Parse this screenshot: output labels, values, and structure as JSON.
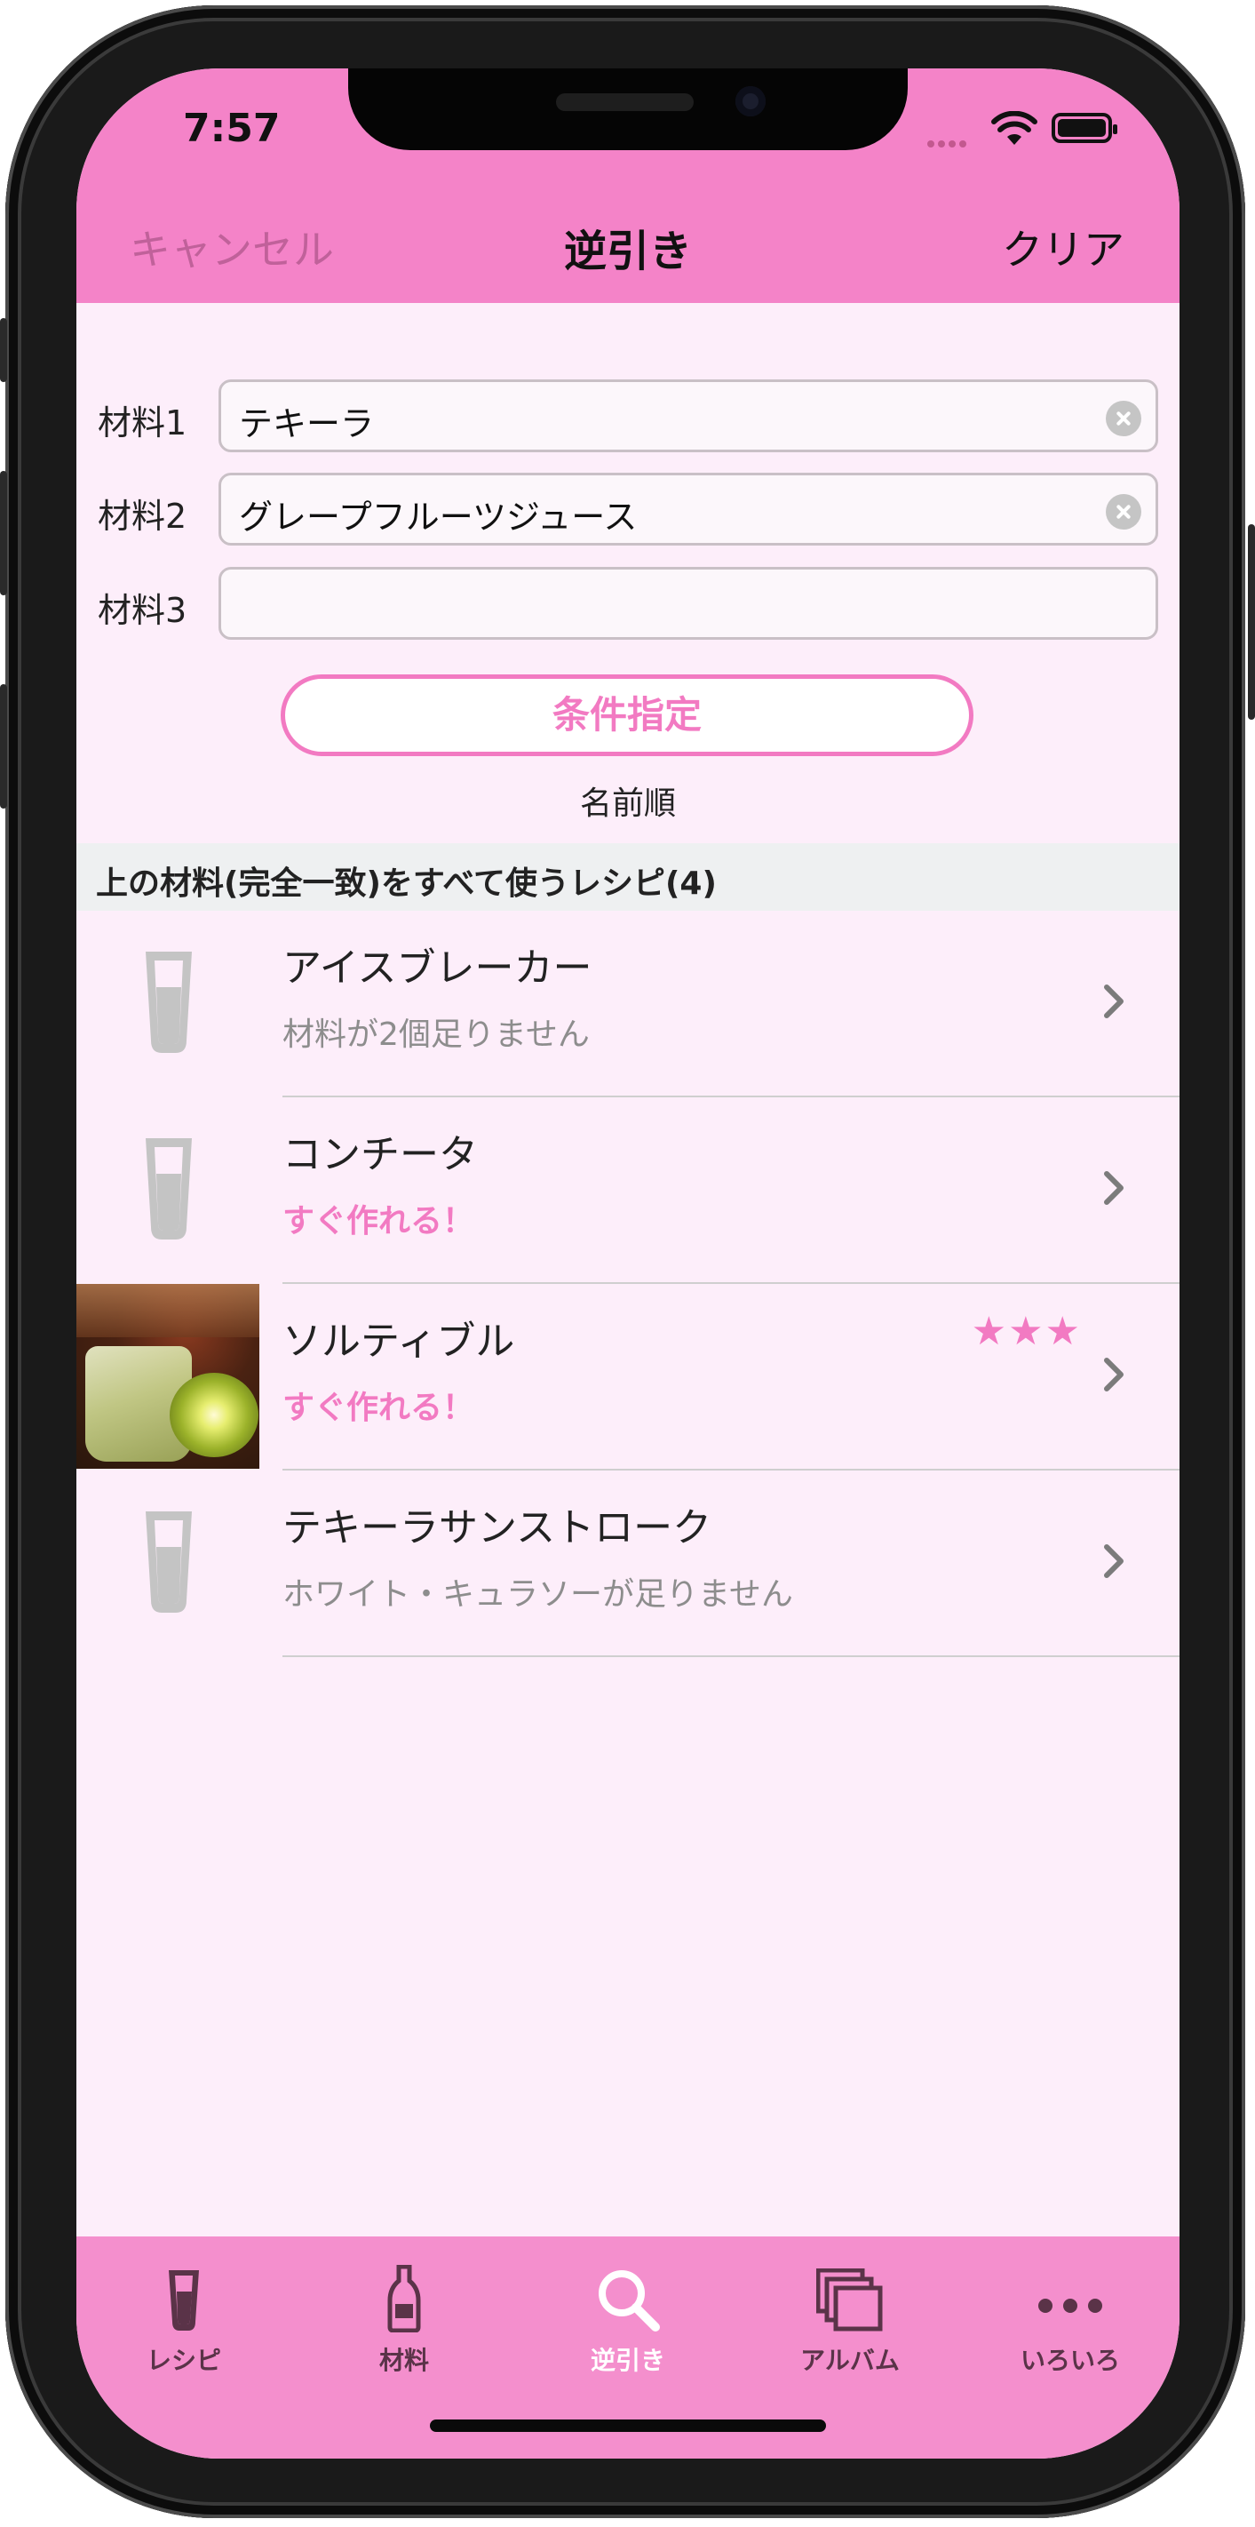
{
  "status_bar": {
    "time": "7:57"
  },
  "nav": {
    "cancel": "キャンセル",
    "title": "逆引き",
    "clear": "クリア"
  },
  "ingredients": [
    {
      "label": "材料1",
      "value": "テキーラ"
    },
    {
      "label": "材料2",
      "value": "グレープフルーツジュース"
    },
    {
      "label": "材料3",
      "value": ""
    }
  ],
  "condition_button": "条件指定",
  "sort_label": "名前順",
  "section_header": "上の材料(完全一致)をすべて使うレシピ(4)",
  "recipes": [
    {
      "name": "アイスブレーカー",
      "status": "材料が2個足りません",
      "stars": "",
      "thumbnail": "glass-icon"
    },
    {
      "name": "コンチータ",
      "status": "すぐ作れる！",
      "stars": "",
      "thumbnail": "glass-icon"
    },
    {
      "name": "ソルティブル",
      "status": "すぐ作れる！",
      "stars": "★★★",
      "thumbnail": "photo"
    },
    {
      "name": "テキーラサンストローク",
      "status": "ホワイト・キュラソーが足りません",
      "stars": "",
      "thumbnail": "glass-icon"
    }
  ],
  "tabs": [
    {
      "label": "レシピ",
      "icon": "glass-icon",
      "active": false
    },
    {
      "label": "材料",
      "icon": "bottle-icon",
      "active": false
    },
    {
      "label": "逆引き",
      "icon": "search-icon",
      "active": true
    },
    {
      "label": "アルバム",
      "icon": "album-icon",
      "active": false
    },
    {
      "label": "いろいろ",
      "icon": "more-icon",
      "active": false
    }
  ],
  "colors": {
    "accent": "#f27ac2",
    "nav_bg": "#f483c8",
    "tab_bg": "#f48fcd",
    "content_bg": "#fdeefa"
  }
}
